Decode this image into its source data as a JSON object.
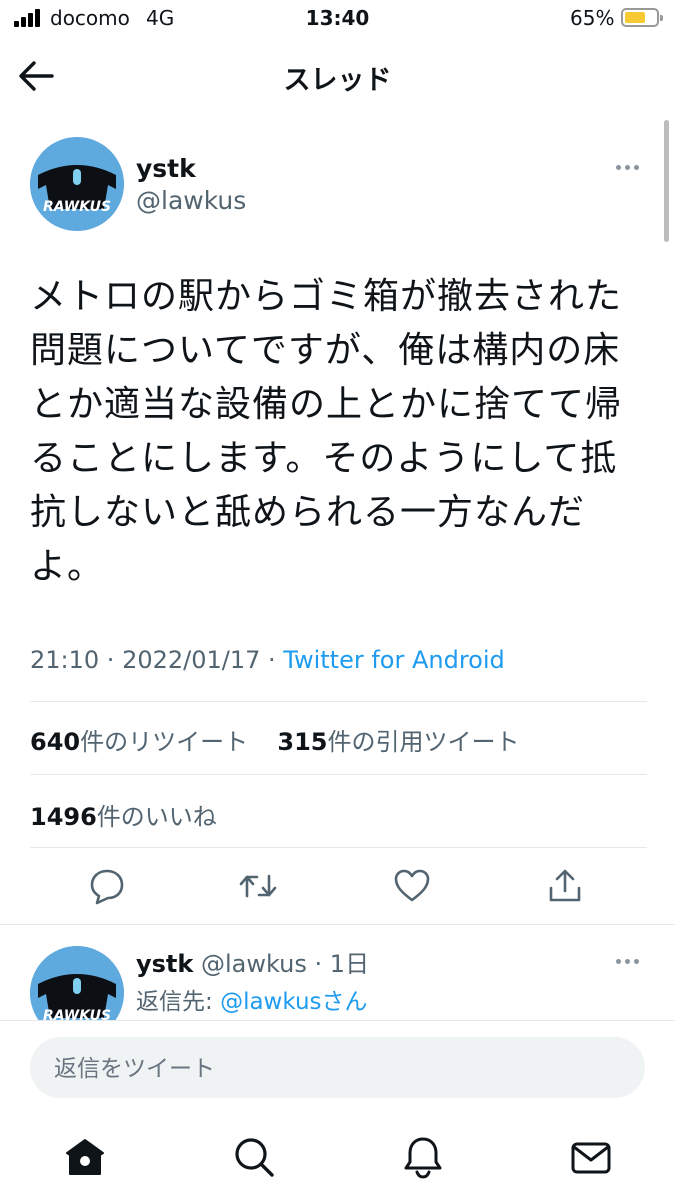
{
  "status_bar": {
    "carrier": "docomo",
    "network": "4G",
    "time": "13:40",
    "battery": "65%",
    "battery_level": 0.65,
    "battery_color": "#f7c933"
  },
  "header": {
    "title": "スレッド",
    "back_icon": "arrow-left-icon"
  },
  "tweet": {
    "avatar_text": "RAWKUS",
    "name": "ystk",
    "handle": "@lawkus",
    "more_icon": "more-dots-icon",
    "text_lines": [
      "メトロの駅からゴミ箱が撤去された",
      "問題についてですが、俺は構内の床",
      "とか適当な設備の上とかに捨てて帰",
      "ることにします。そのようにして抵",
      "抗しないと舐められる一方なんだ",
      "よ。"
    ],
    "time": "21:10",
    "date": "2022/01/17",
    "separator": " · ",
    "source": "Twitter for Android",
    "retweets": {
      "count": "640",
      "label": "件のリツイート"
    },
    "quotes": {
      "count": "315",
      "label": "件の引用ツイート"
    },
    "likes": {
      "count": "1496",
      "label": "件のいいね"
    },
    "actions": [
      "reply-icon",
      "retweet-icon",
      "like-icon",
      "share-icon"
    ]
  },
  "reply_tweet": {
    "avatar_text": "RAWKUS",
    "name": "ystk",
    "handle": "@lawkus",
    "age": "1日",
    "reply_to_label": "返信先: ",
    "reply_to_handle": "@lawkusさん"
  },
  "compose": {
    "placeholder": "返信をツイート"
  },
  "tab_bar": {
    "items": [
      "home-icon",
      "search-icon",
      "notifications-icon",
      "messages-icon"
    ]
  },
  "colors": {
    "accent": "#1d9bf0",
    "secondary_text": "#536471",
    "avatar_bg": "#5ea9dd"
  }
}
